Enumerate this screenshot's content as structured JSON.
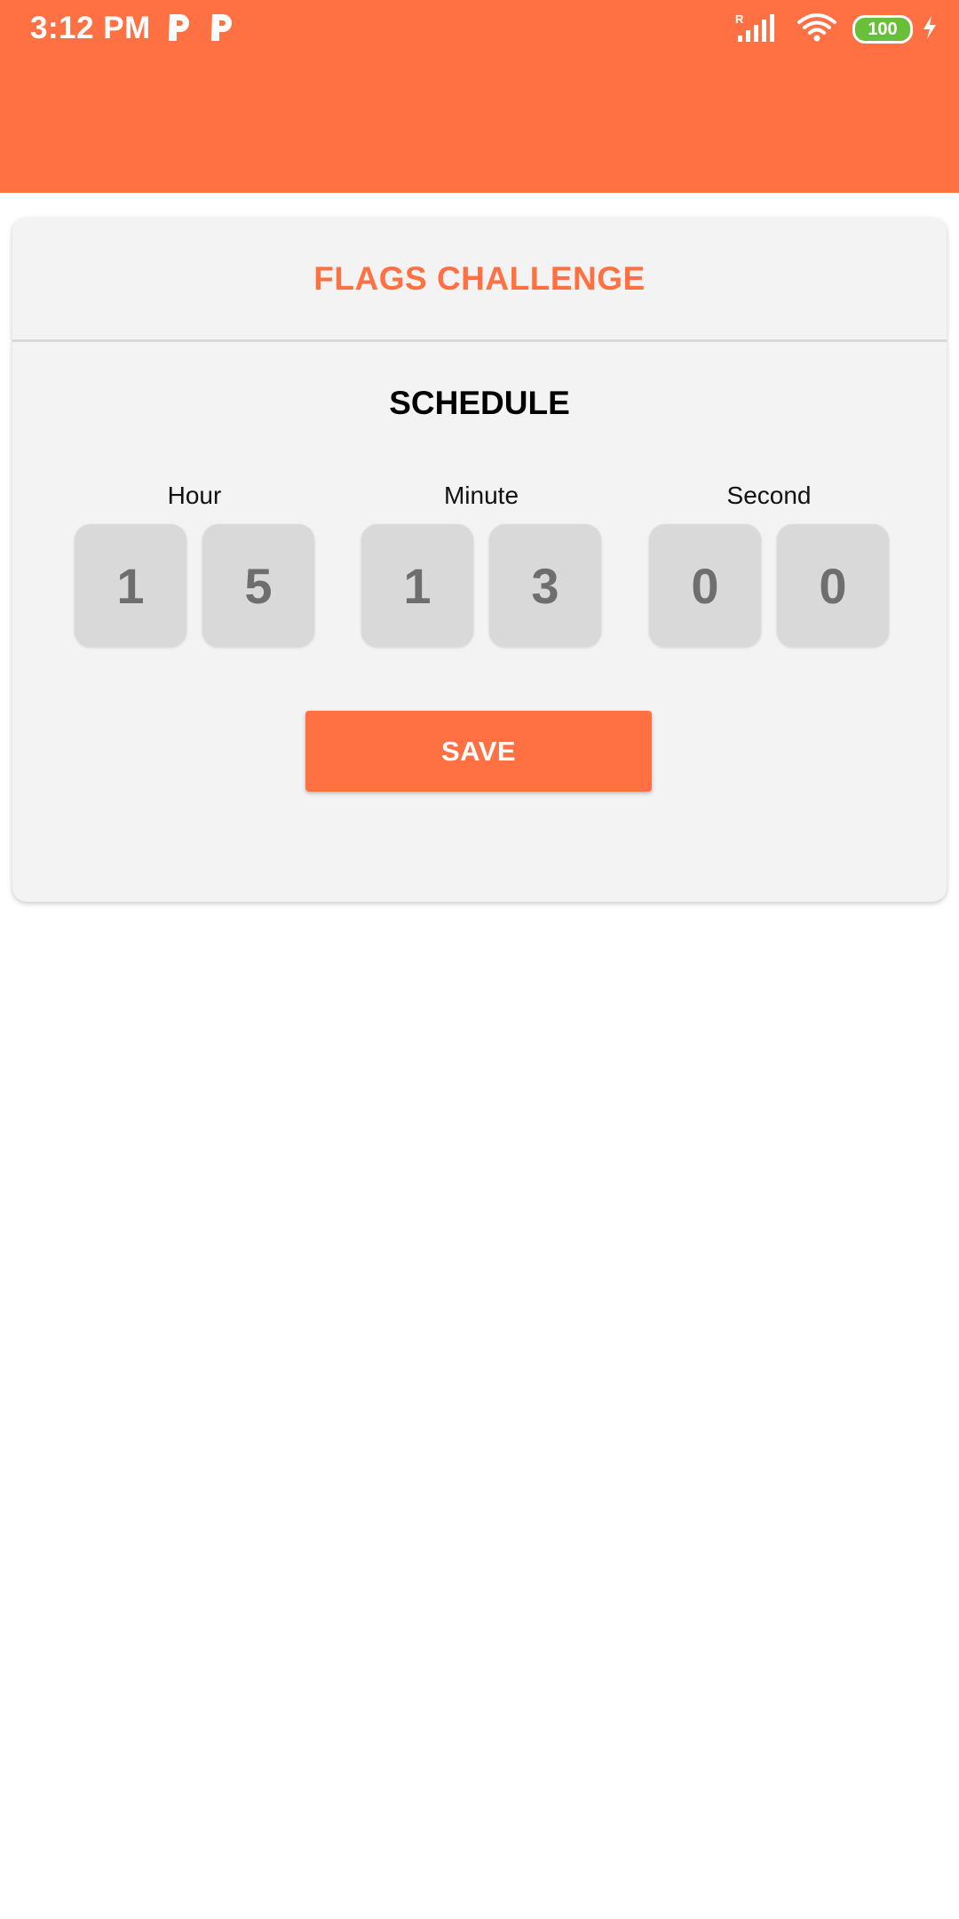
{
  "status_bar": {
    "time": "3:12 PM",
    "notification_icons": [
      "p-app-icon",
      "p-app-icon"
    ],
    "signal_label": "R",
    "battery_level": "100"
  },
  "card": {
    "title": "FLAGS CHALLENGE",
    "section_title": "SCHEDULE",
    "groups": [
      {
        "label": "Hour",
        "digits": [
          "1",
          "5"
        ]
      },
      {
        "label": "Minute",
        "digits": [
          "1",
          "3"
        ]
      },
      {
        "label": "Second",
        "digits": [
          "0",
          "0"
        ]
      }
    ],
    "save_label": "SAVE"
  },
  "colors": {
    "accent": "#FF7043",
    "card_bg": "#F3F3F3",
    "digit_bg": "#D9D9D9",
    "digit_text": "#6E6E6E",
    "battery": "#6ABF3A"
  }
}
